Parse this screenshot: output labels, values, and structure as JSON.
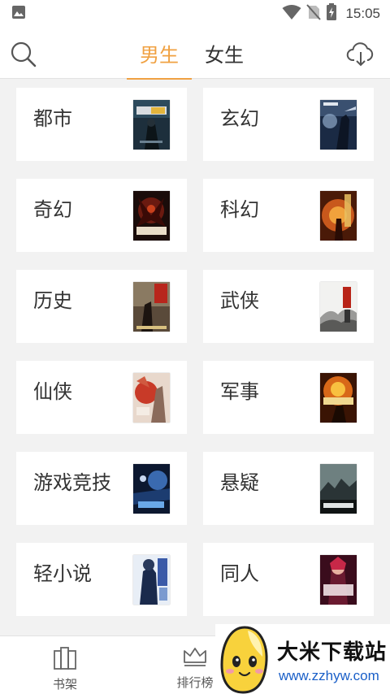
{
  "status_bar": {
    "time": "15:05",
    "icons": [
      "image-icon",
      "wifi-icon",
      "no-sim-icon",
      "battery-charging-icon"
    ]
  },
  "header": {
    "search_icon": "search-icon",
    "download_icon": "cloud-download-icon",
    "tabs": [
      {
        "label": "男生",
        "active": true
      },
      {
        "label": "女生",
        "active": false
      }
    ],
    "accent_color": "#f0a142"
  },
  "categories": [
    {
      "label": "都市"
    },
    {
      "label": "玄幻"
    },
    {
      "label": "奇幻"
    },
    {
      "label": "科幻"
    },
    {
      "label": "历史"
    },
    {
      "label": "武侠"
    },
    {
      "label": "仙侠"
    },
    {
      "label": "军事"
    },
    {
      "label": "游戏竞技"
    },
    {
      "label": "悬疑"
    },
    {
      "label": "轻小说"
    },
    {
      "label": "同人"
    }
  ],
  "bottom_nav": {
    "items": [
      {
        "label": "书架",
        "icon": "bookshelf-icon"
      },
      {
        "label": "排行榜",
        "icon": "crown-icon"
      }
    ]
  },
  "watermark": {
    "title": "大米下载站",
    "url": "www.zzhyw.com"
  }
}
